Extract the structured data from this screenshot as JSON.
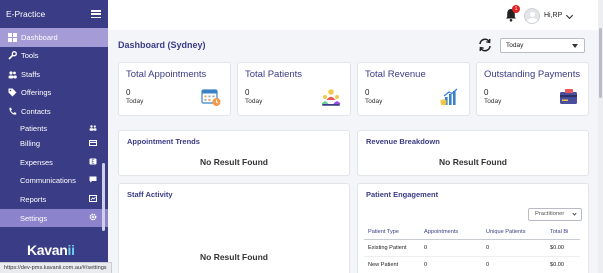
{
  "app": {
    "name": "E-Practice"
  },
  "sidebar": {
    "items": [
      {
        "label": "Dashboard"
      },
      {
        "label": "Tools"
      },
      {
        "label": "Staffs"
      },
      {
        "label": "Offerings"
      },
      {
        "label": "Contacts"
      }
    ],
    "sub_items": [
      {
        "label": "Patients"
      },
      {
        "label": "Billing"
      },
      {
        "label": "Expenses"
      },
      {
        "label": "Communications"
      },
      {
        "label": "Reports"
      },
      {
        "label": "Settings"
      }
    ],
    "logo_main": "Kavan",
    "logo_accent": "ii"
  },
  "status_bar": {
    "url": "https://dev-pms.kavanii.com.au/#/settings"
  },
  "topbar": {
    "notification_count": "1",
    "user_name": "Hi,RP"
  },
  "header": {
    "title": "Dashboard (Sydney)",
    "period_select": "Today"
  },
  "stats": [
    {
      "title": "Total Appointments",
      "value": "0",
      "sub": "Today",
      "icon": "calendar-icon"
    },
    {
      "title": "Total Patients",
      "value": "0",
      "sub": "Today",
      "icon": "patients-icon"
    },
    {
      "title": "Total Revenue",
      "value": "0",
      "sub": "Today",
      "icon": "revenue-icon"
    },
    {
      "title": "Outstanding Payments",
      "value": "0",
      "sub": "Today",
      "icon": "payments-icon"
    }
  ],
  "panels": {
    "appointment_trends": {
      "title": "Appointment Trends",
      "empty": "No Result Found"
    },
    "revenue_breakdown": {
      "title": "Revenue Breakdown",
      "empty": "No Result Found"
    },
    "staff_activity": {
      "title": "Staff Activity",
      "empty": "No Result Found"
    },
    "patient_engagement": {
      "title": "Patient Engagement",
      "filter": "Practitioner",
      "columns": [
        "Patient Type",
        "Appointments",
        "Unique Patients",
        "Total Bi"
      ],
      "rows": [
        [
          "Existing Patient",
          "0",
          "0",
          "$0.00"
        ],
        [
          "New Patient",
          "0",
          "0",
          "$0.00"
        ]
      ]
    }
  },
  "colors": {
    "brand": "#3a3c86",
    "active": "#a49bd7",
    "settings": "#8b83cc"
  }
}
